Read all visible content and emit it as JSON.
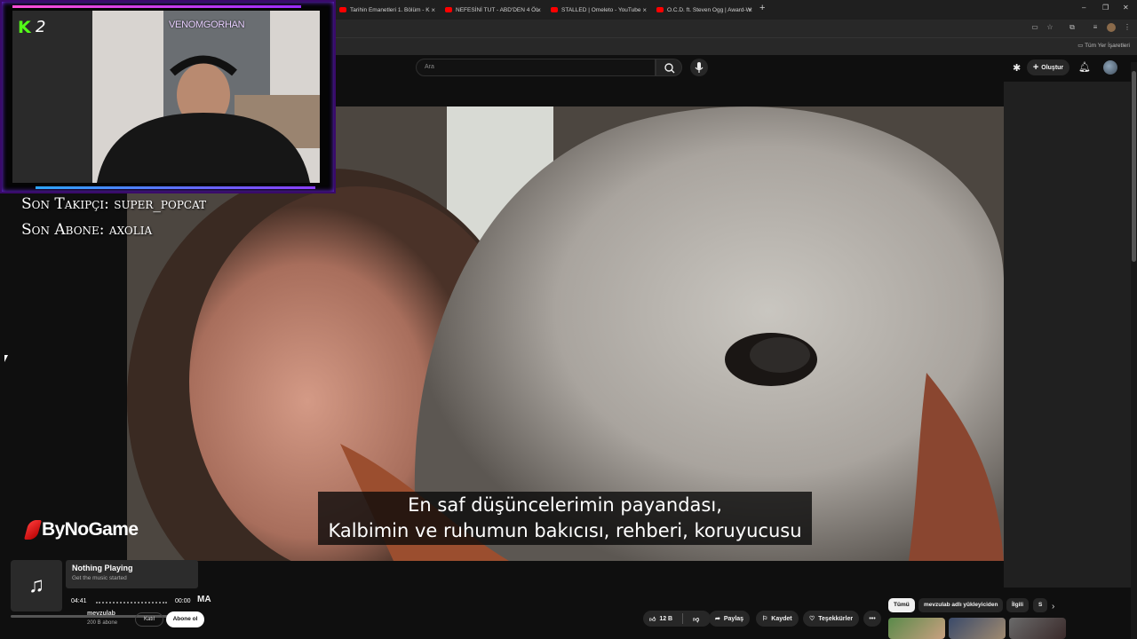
{
  "browser": {
    "tabs": [
      {
        "title": "Tarihin Emanetleri 1. Bölüm - K"
      },
      {
        "title": "NEFESİNİ TUT - ABD'DEN 4 ÖL"
      },
      {
        "title": "STALLED | Omeleto - YouTube"
      },
      {
        "title": "O.C.D. ft. Steven Ogg | Award-W"
      }
    ],
    "new_tab": "+",
    "close_glyph": "×",
    "bookmarks_label": "Tüm Yer İşaretleri"
  },
  "youtube": {
    "search_placeholder": "Ara",
    "create_label": "Oluştur",
    "subtitle_line1": "En saf düşüncelerimin payandası,",
    "subtitle_line2": "Kalbimin ve ruhumun bakıcısı, rehberi, koruyucusu",
    "title_tail": "MA",
    "channel_name": "mevzulab",
    "channel_subs": "200 B abone",
    "join_label": "Katıl",
    "subscribe_label": "Abone ol",
    "like_count": "12 B",
    "share_label": "Paylaş",
    "save_label": "Kaydet",
    "thanks_label": "Teşekkürler",
    "more_label": "•••",
    "chips": [
      "Tümü",
      "mevzulab adlı yükleyiciden",
      "İlgili",
      "S"
    ],
    "next_chip_icon": "chevron-right-icon"
  },
  "stream_overlay": {
    "kick_logo": "K",
    "kick_number": "2",
    "streamer_name": "VENOMGORHAN",
    "last_follower": "Son Takipçi: super_popcat",
    "last_subscriber": "Son Abone: axolia",
    "sponsor": "ByNoGame"
  },
  "music_widget": {
    "title": "Nothing Playing",
    "subtitle": "Get the music started",
    "elapsed": "04:41",
    "total": "00:00",
    "icon": "music-note-icon"
  },
  "colors": {
    "kick_green": "#53fc18",
    "overlay_pink": "#ff4fd8",
    "overlay_purple": "#9b2bff",
    "yt_red": "#ff0000"
  }
}
